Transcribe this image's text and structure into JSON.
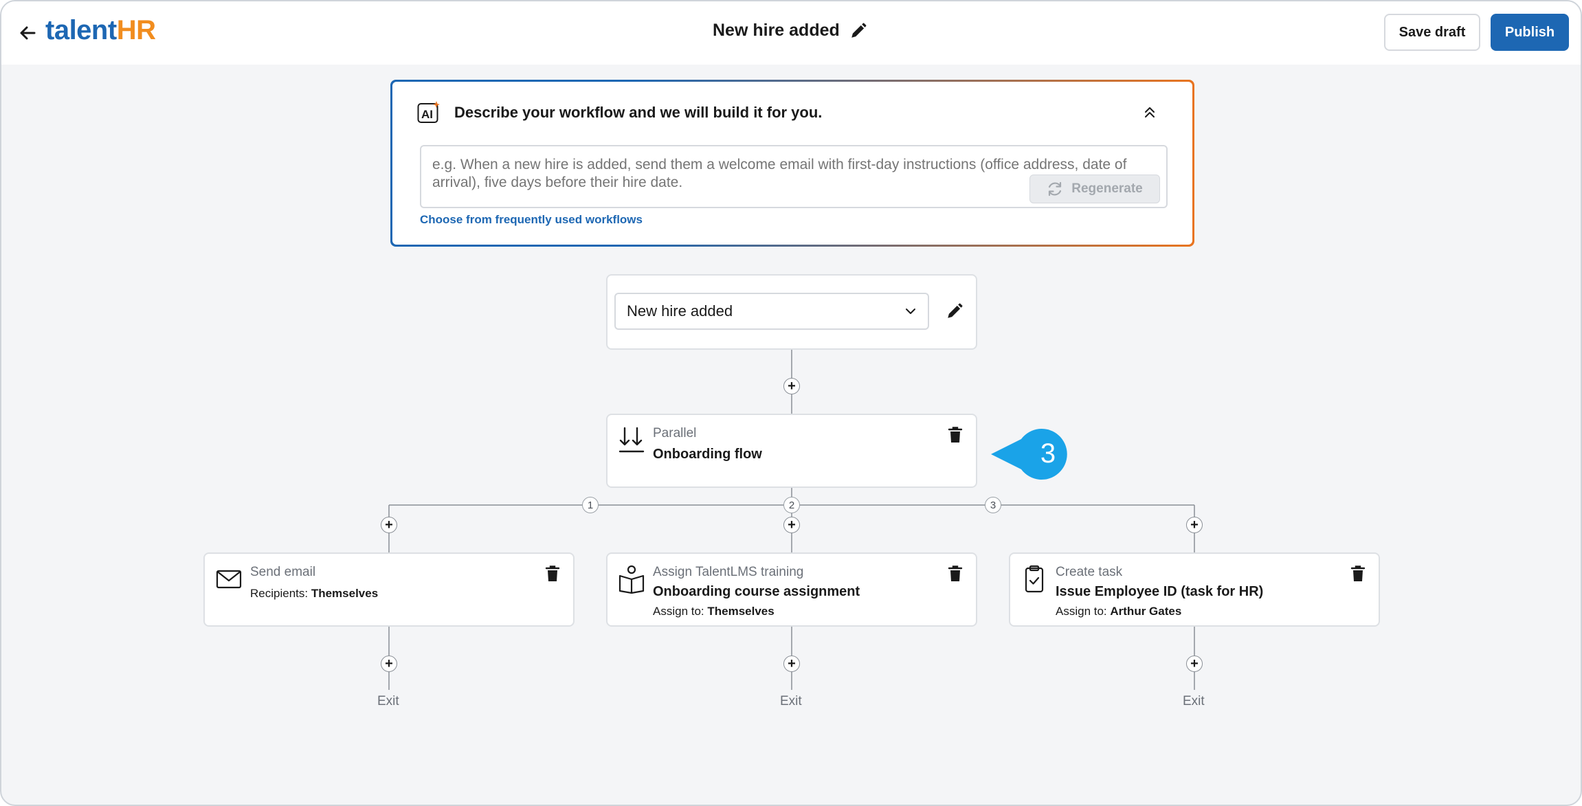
{
  "header": {
    "logo_part1": "talent",
    "logo_part2": "HR",
    "title": "New hire added",
    "save_draft_label": "Save draft",
    "publish_label": "Publish",
    "brand_color": "#1d67b3",
    "accent_color": "#f18d1f"
  },
  "ai_panel": {
    "icon_text": "AI",
    "heading": "Describe your workflow and we will build it for you.",
    "placeholder": "e.g. When a new hire is added, send them a welcome email with first-day instructions (office address, date of arrival), five days before their hire date.",
    "regenerate_label": "Regenerate",
    "link_label": "Choose from frequently used workflows"
  },
  "trigger": {
    "selected": "New hire added"
  },
  "parallel": {
    "kind": "Parallel",
    "name": "Onboarding flow",
    "branch_numbers": [
      "1",
      "2",
      "3"
    ]
  },
  "actions": [
    {
      "icon": "envelope-icon",
      "kind": "Send email",
      "meta_label": "Recipients: ",
      "meta_value": "Themselves"
    },
    {
      "icon": "book-reader-icon",
      "kind": "Assign TalentLMS training",
      "name": "Onboarding course assignment",
      "meta_label": "Assign to: ",
      "meta_value": "Themselves"
    },
    {
      "icon": "clipboard-check-icon",
      "kind": "Create task",
      "name": "Issue Employee ID (task for HR)",
      "meta_label": "Assign to: ",
      "meta_value": "Arthur Gates"
    }
  ],
  "exit_label": "Exit",
  "callout": {
    "number": "3",
    "color": "#1aa3e8"
  }
}
